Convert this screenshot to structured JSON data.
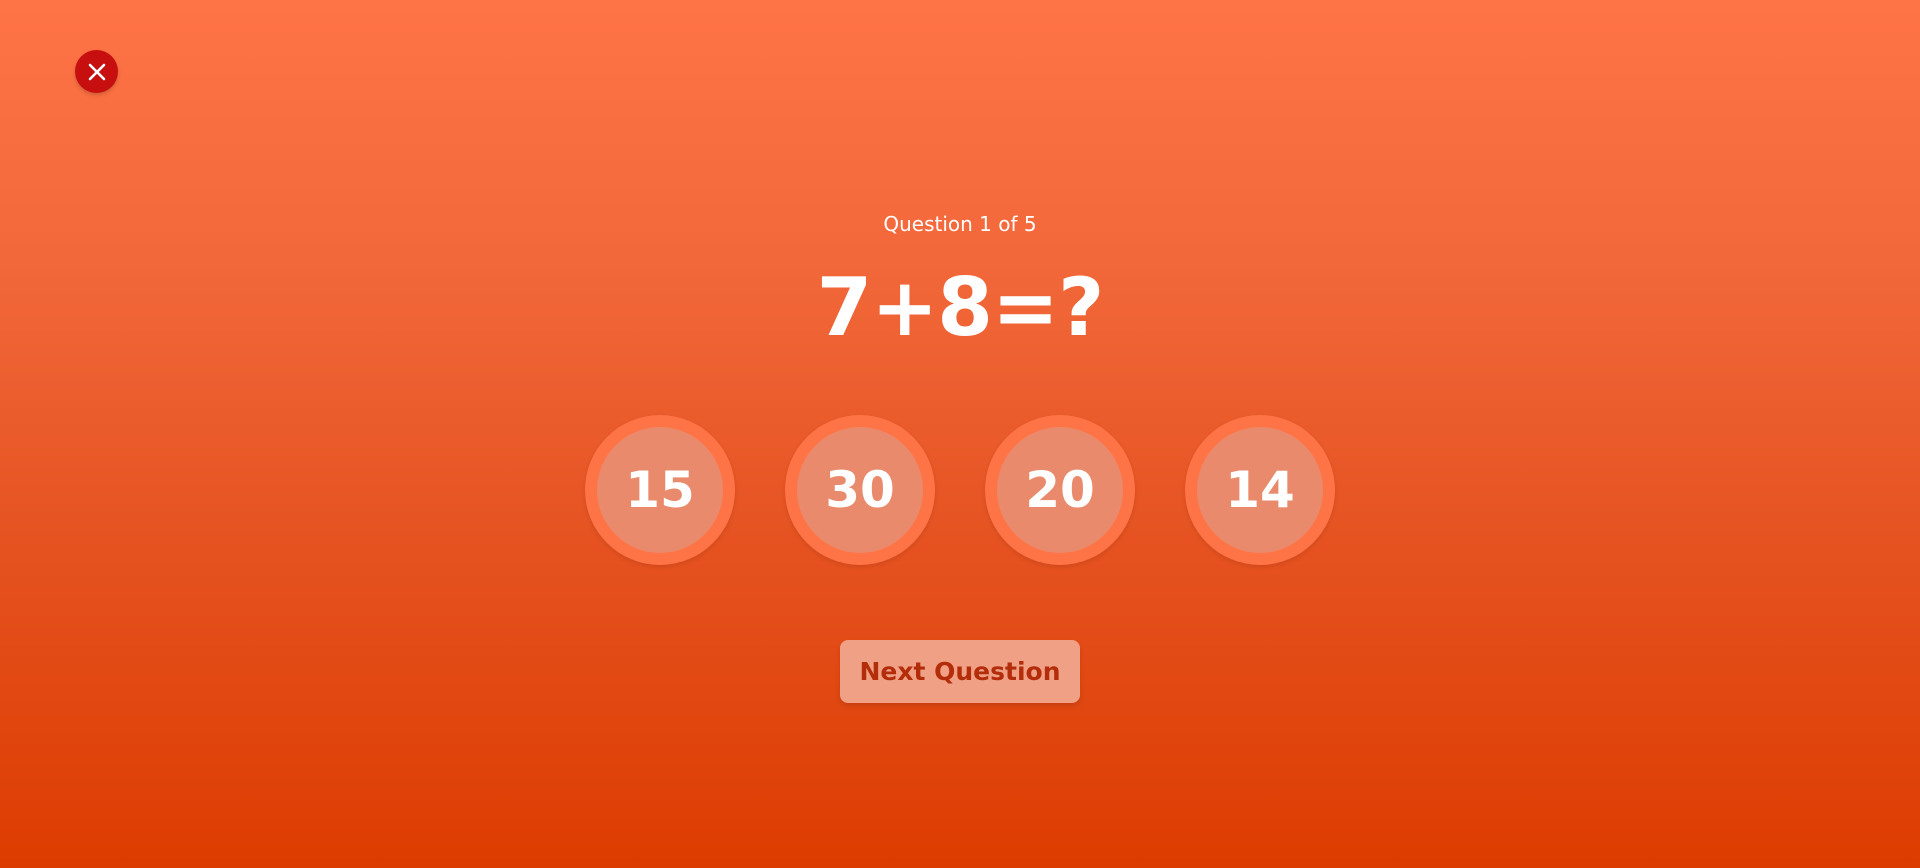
{
  "close": {
    "icon": "close-icon",
    "color": "#c70f0f"
  },
  "quiz": {
    "counter": "Question 1 of 5",
    "question": "7+8=?",
    "answers": [
      "15",
      "30",
      "20",
      "14"
    ],
    "next_label": "Next Question"
  },
  "colors": {
    "background_top": "#ff7446",
    "background_bottom": "#dd3c00",
    "answer_ring": "#ff7446",
    "answer_fill": "#ea8a6c",
    "button_fill": "#f0a085",
    "button_text": "#b32d0a"
  }
}
